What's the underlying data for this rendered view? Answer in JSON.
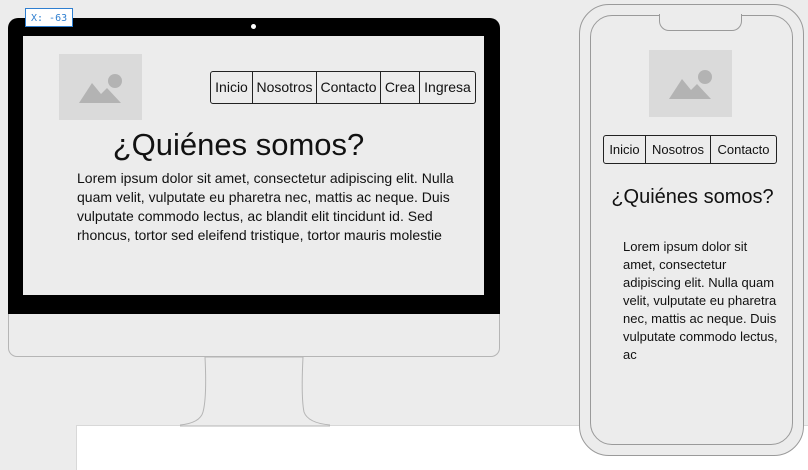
{
  "coord_badge": "X: -63",
  "desktop": {
    "nav": [
      "Inicio",
      "Nosotros",
      "Contacto",
      "Crea",
      "Ingresa"
    ],
    "title": "¿Quiénes somos?",
    "body": "Lorem ipsum dolor sit amet, consectetur adipiscing elit. Nulla quam velit, vulputate eu pharetra nec, mattis ac neque. Duis vulputate commodo lectus, ac blandit elit tincidunt id. Sed rhoncus, tortor sed eleifend tristique, tortor mauris molestie"
  },
  "phone": {
    "nav": [
      "Inicio",
      "Nosotros",
      "Contacto"
    ],
    "title": "¿Quiénes somos?",
    "body": "Lorem ipsum dolor sit amet, consectetur adipiscing elit. Nulla quam velit, vulputate eu pharetra nec, mattis ac neque. Duis vulputate commodo lectus, ac"
  },
  "icons": {
    "image_placeholder": "image-icon"
  },
  "colors": {
    "background": "#ececec",
    "badge_accent": "#2f7fd0",
    "monitor_bezel": "#000000",
    "placeholder_fill": "#dadada",
    "placeholder_glyph": "#b3b3b3"
  }
}
